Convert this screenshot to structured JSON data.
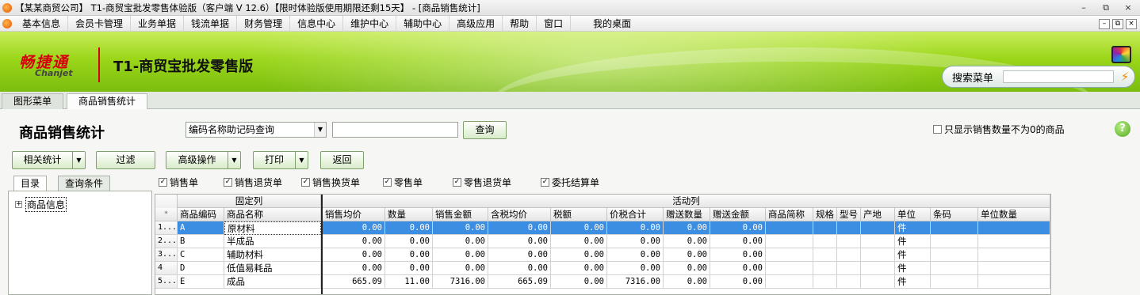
{
  "window": {
    "title": "【某某商贸公司】 T1-商贸宝批发零售体验版（客户端 V 12.6）【限时体验版使用期限还剩15天】 - [商品销售统计]",
    "controls": [
      "–",
      "⧉",
      "×"
    ]
  },
  "menu": {
    "items": [
      "基本信息",
      "会员卡管理",
      "业务单据",
      "钱流单据",
      "财务管理",
      "信息中心",
      "维护中心",
      "辅助中心",
      "高级应用",
      "帮助",
      "窗口",
      "我的桌面"
    ]
  },
  "banner": {
    "brand_cn": "畅捷通",
    "brand_en": "Chanjet",
    "product": "T1-商贸宝批发零售版",
    "search_label": "搜索菜单",
    "search_value": ""
  },
  "tabs": [
    "图形菜单",
    "商品销售统计"
  ],
  "page": {
    "title": "商品销售统计",
    "query_type": "编码名称助记码查询",
    "query_value": "",
    "query_button": "查询",
    "only_nonzero_label": "只显示销售数量不为0的商品",
    "only_nonzero_checked": false,
    "help": "?"
  },
  "toolbar": {
    "related_stats": "相关统计",
    "filter": "过滤",
    "advanced": "高级操作",
    "print": "打印",
    "back": "返回"
  },
  "filters": [
    {
      "label": "销售单",
      "checked": true
    },
    {
      "label": "销售退货单",
      "checked": true
    },
    {
      "label": "销售换货单",
      "checked": true
    },
    {
      "label": "零售单",
      "checked": true
    },
    {
      "label": "零售退货单",
      "checked": true
    },
    {
      "label": "委托结算单",
      "checked": true
    }
  ],
  "left_panel": {
    "tabs": [
      "目录",
      "查询条件"
    ],
    "tree_root": "商品信息"
  },
  "grid": {
    "group_fixed": "固定列",
    "group_active": "活动列",
    "corner": "*",
    "columns": [
      "商品编码",
      "商品名称",
      "销售均价",
      "数量",
      "销售金额",
      "含税均价",
      "税额",
      "价税合计",
      "赠送数量",
      "赠送金额",
      "商品简称",
      "规格",
      "型号",
      "产地",
      "单位",
      "条码",
      "单位数量"
    ],
    "rows": [
      {
        "idx": "1...",
        "code": "A",
        "name": "原材料",
        "avg": "0.00",
        "qty": "0.00",
        "amount": "0.00",
        "tax_avg": "0.00",
        "tax": "0.00",
        "total": "0.00",
        "gift_qty": "0.00",
        "gift_amt": "0.00",
        "unit": "件"
      },
      {
        "idx": "2...",
        "code": "B",
        "name": "半成品",
        "avg": "0.00",
        "qty": "0.00",
        "amount": "0.00",
        "tax_avg": "0.00",
        "tax": "0.00",
        "total": "0.00",
        "gift_qty": "0.00",
        "gift_amt": "0.00",
        "unit": "件"
      },
      {
        "idx": "3...",
        "code": "C",
        "name": "辅助材料",
        "avg": "0.00",
        "qty": "0.00",
        "amount": "0.00",
        "tax_avg": "0.00",
        "tax": "0.00",
        "total": "0.00",
        "gift_qty": "0.00",
        "gift_amt": "0.00",
        "unit": "件"
      },
      {
        "idx": "4",
        "code": "D",
        "name": "低值易耗品",
        "avg": "0.00",
        "qty": "0.00",
        "amount": "0.00",
        "tax_avg": "0.00",
        "tax": "0.00",
        "total": "0.00",
        "gift_qty": "0.00",
        "gift_amt": "0.00",
        "unit": "件"
      },
      {
        "idx": "5...",
        "code": "E",
        "name": "成品",
        "avg": "665.09",
        "qty": "11.00",
        "amount": "7316.00",
        "tax_avg": "665.09",
        "tax": "0.00",
        "total": "7316.00",
        "gift_qty": "0.00",
        "gift_amt": "0.00",
        "unit": "件"
      }
    ]
  },
  "colors": {
    "banner_green": "#9bd619",
    "selection_blue": "#3c8ee2",
    "brand_red": "#d7000f"
  }
}
